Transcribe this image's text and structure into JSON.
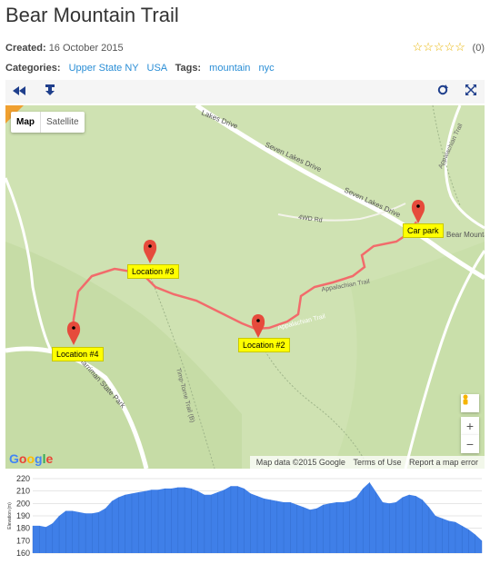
{
  "page": {
    "title": "Bear Mountain Trail",
    "created_label": "Created:",
    "created_value": "16 October 2015",
    "categories_label": "Categories:",
    "categories": [
      "Upper State NY",
      "USA"
    ],
    "tags_label": "Tags:",
    "tags": [
      "mountain",
      "nyc"
    ],
    "rating": {
      "stars_text": "☆☆☆☆☆",
      "count": "(0)"
    }
  },
  "toolbar": {
    "left_icons": [
      "rewind-icon",
      "download-icon"
    ],
    "right_icons": [
      "refresh-icon",
      "fullscreen-icon"
    ]
  },
  "map": {
    "type_control": {
      "map_label": "Map",
      "satellite_label": "Satellite"
    },
    "road_labels": [
      "Lakes Drive",
      "Seven Lakes Drive",
      "Seven Lakes Drive",
      "4WD Rd",
      "Appalachian Trail",
      "Appalachian Trail",
      "Harriman State Park",
      "Timp-Torne Trail (B)",
      "Bear Mountain State Park",
      "Appalachian Trail"
    ],
    "markers": [
      "Car park",
      "Location #2",
      "Location #3",
      "Location #4"
    ],
    "google_logo": "Google",
    "attribution": [
      "Map data ©2015 Google",
      "Terms of Use",
      "Report a map error"
    ],
    "controls": {
      "zoom_in": "+",
      "zoom_out": "−"
    },
    "colors": {
      "land": "#cfe2b2",
      "road": "#ffffff",
      "track": "#f26b6b",
      "marker": "#e64b3c",
      "label_bg": "#ffff00"
    }
  },
  "chart_data": {
    "type": "area",
    "ylabel": "Elevation (m)",
    "ylim": [
      160,
      220
    ],
    "yticks": [
      160,
      170,
      180,
      190,
      200,
      210,
      220
    ],
    "color": "#3f7fe8",
    "values": [
      182,
      182,
      181,
      184,
      190,
      194,
      194,
      193,
      192,
      192,
      193,
      196,
      202,
      205,
      207,
      208,
      209,
      210,
      211,
      211,
      212,
      212,
      213,
      213,
      212,
      210,
      207,
      207,
      209,
      211,
      214,
      214,
      212,
      208,
      206,
      204,
      203,
      202,
      201,
      201,
      199,
      197,
      195,
      196,
      199,
      200,
      201,
      201,
      202,
      205,
      212,
      217,
      209,
      201,
      200,
      201,
      205,
      207,
      206,
      203,
      197,
      190,
      188,
      186,
      185,
      182,
      179,
      175,
      170
    ]
  }
}
